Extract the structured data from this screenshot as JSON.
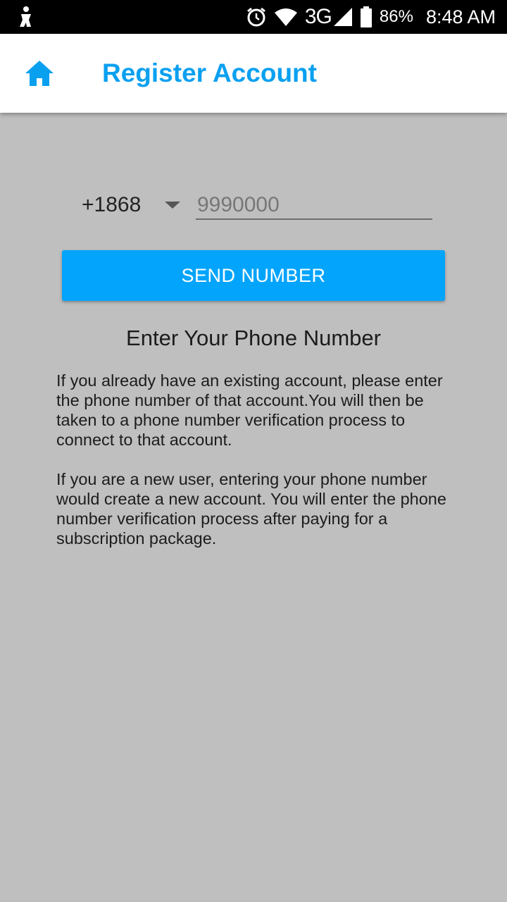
{
  "status_bar": {
    "left_icon": "notification-app-icon",
    "alarm_icon": "alarm-clock-icon",
    "wifi_icon": "wifi-icon",
    "network": "3G",
    "signal_icon": "cell-signal-icon",
    "battery_icon": "battery-icon",
    "battery_percent": "86%",
    "time": "8:48 AM"
  },
  "app_bar": {
    "home_icon": "home-icon",
    "title": "Register Account",
    "accent_color": "#0aa0f0"
  },
  "form": {
    "country_code": "+1868",
    "phone_placeholder": "9990000",
    "send_button_label": "SEND NUMBER",
    "button_color": "#03a4fb"
  },
  "content": {
    "heading": "Enter Your Phone Number",
    "paragraph1": "If you already have an existing account, please enter the phone number of that account.You will then be taken to a phone number verification process to connect to that account.",
    "paragraph2": "If you are a new user, entering your phone number would create a new account. You will enter the phone number verification process after paying for a subscription package."
  }
}
